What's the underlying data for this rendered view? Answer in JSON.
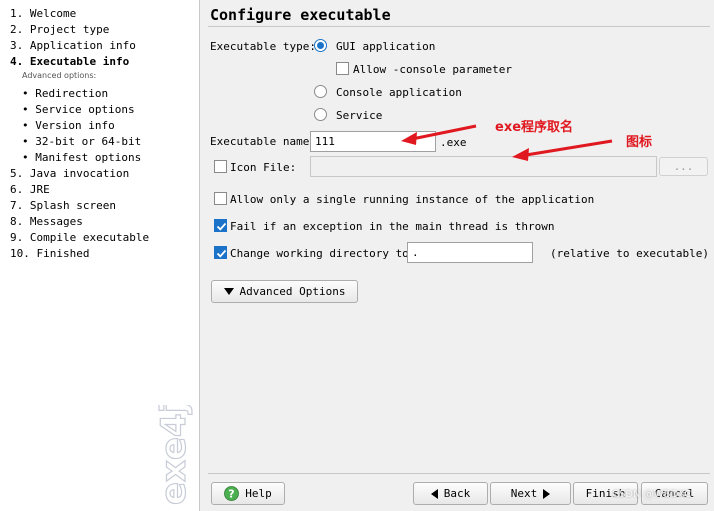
{
  "sidebar": {
    "steps": [
      "1. Welcome",
      "2. Project type",
      "3. Application info",
      "4. Executable info",
      "5. Java invocation",
      "6. JRE",
      "7. Splash screen",
      "8. Messages",
      "9. Compile executable",
      "10. Finished"
    ],
    "advanced_label": "Advanced options:",
    "substeps": [
      "• Redirection",
      "• Service options",
      "• Version info",
      "• 32-bit or 64-bit",
      "• Manifest options"
    ],
    "logo_text": "exe4j"
  },
  "main": {
    "title": "Configure executable",
    "executable_type_label": "Executable type:",
    "type_options": [
      "GUI application",
      "Allow -console parameter",
      "Console application",
      "Service"
    ],
    "selected_type": "GUI application",
    "executable_name_label": "Executable name:",
    "executable_name_value": "111",
    "exe_suffix": ".exe",
    "icon_file_label": "Icon File:",
    "icon_file_value": "",
    "browse_label": "...",
    "single_instance_label": "Allow only a single running instance of the application",
    "fail_exception_label": "Fail if an exception in the main thread is thrown",
    "change_dir_label": "Change working directory to:",
    "change_dir_value": ".",
    "relative_label": "(relative to executable)",
    "advanced_options_label": "Advanced Options"
  },
  "checkboxes": {
    "allow_console": false,
    "icon_file": false,
    "single_instance": false,
    "fail_exception": true,
    "change_dir": true
  },
  "buttons": {
    "help": "Help",
    "back": "Back",
    "next": "Next",
    "finish": "Finish",
    "cancel": "Cancel"
  },
  "annotations": {
    "exe_name_note": "exe程序取名",
    "icon_note": "图标"
  },
  "watermark": "CSDN @WBDXC",
  "colors": {
    "accent": "#1a73c9",
    "annotation": "#e0181f",
    "help_icon": "#4caf50"
  }
}
